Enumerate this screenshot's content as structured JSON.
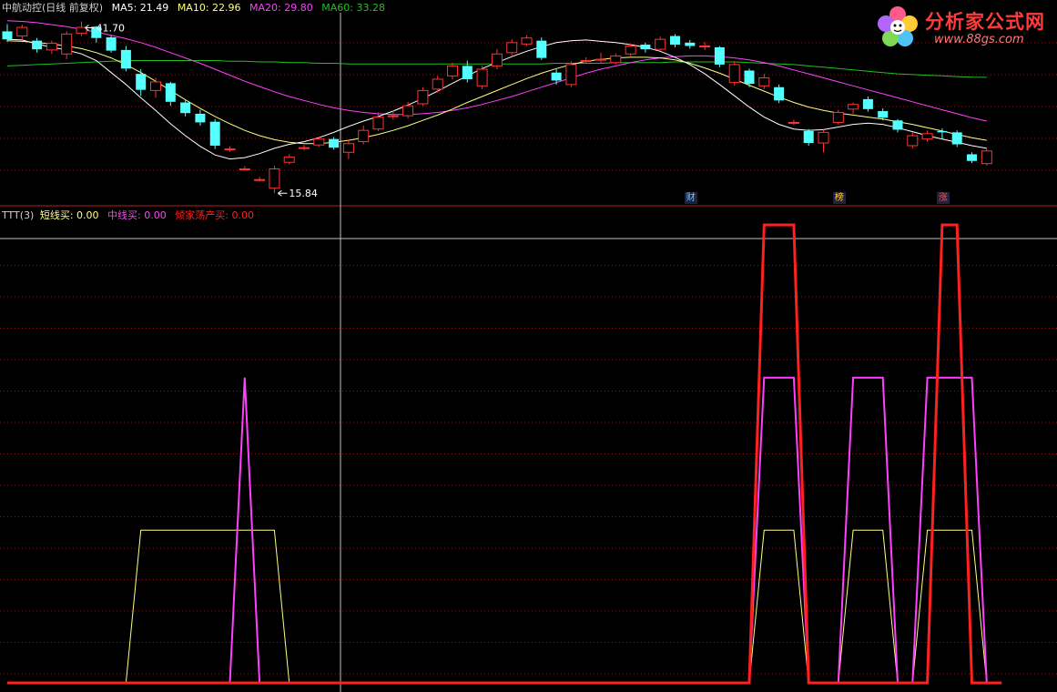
{
  "header_top": {
    "title": "中航动控(日线 前复权)",
    "ma5": "MA5: 21.49",
    "ma10": "MA10: 22.96",
    "ma20": "MA20: 29.80",
    "ma60": "MA60: 33.28"
  },
  "header_bottom": {
    "name": "TTT(3)",
    "short": "短线买: 0.00",
    "mid": "中线买: 0.00",
    "all": "倾家荡产买: 0.00"
  },
  "logo": {
    "text": "分析家公式网",
    "url": "www.88gs.com"
  },
  "colors": {
    "up": "#ff3333",
    "down": "#54ffff",
    "ma5": "#ffffff",
    "ma10": "#ffff80",
    "ma20": "#ff40ff",
    "ma60": "#20c020",
    "short": "#ffff80",
    "mid": "#ff40ff",
    "all": "#ff2020",
    "grid": "#801818",
    "cross": "#c0c0c0"
  },
  "chart_data": [
    {
      "type": "candlestick",
      "x_count": 67,
      "high_label": "41.70",
      "low_label": "15.84",
      "price_range": [
        14.5,
        43.0
      ],
      "candles": [
        [
          40.2,
          39.0,
          41.3,
          38.6
        ],
        [
          39.5,
          40.8,
          41.2,
          38.9
        ],
        [
          38.8,
          37.5,
          39.2,
          37.0
        ],
        [
          37.4,
          38.4,
          38.8,
          36.8
        ],
        [
          36.8,
          39.8,
          40.2,
          36.0
        ],
        [
          39.9,
          40.8,
          41.7,
          39.5
        ],
        [
          40.9,
          39.2,
          41.0,
          38.5
        ],
        [
          39.3,
          37.3,
          39.6,
          37.0
        ],
        [
          37.4,
          34.6,
          38.0,
          34.2
        ],
        [
          33.8,
          31.4,
          34.5,
          30.5
        ],
        [
          31.3,
          32.6,
          33.2,
          30.2
        ],
        [
          32.4,
          29.6,
          32.6,
          29.0
        ],
        [
          29.5,
          27.9,
          29.8,
          27.4
        ],
        [
          27.8,
          26.5,
          28.4,
          26.0
        ],
        [
          26.6,
          23.0,
          27.0,
          22.5
        ],
        [
          22.5,
          22.5,
          22.9,
          22.1
        ],
        [
          19.5,
          19.5,
          19.9,
          19.3
        ],
        [
          17.9,
          17.9,
          18.3,
          17.6
        ],
        [
          16.6,
          19.5,
          20.0,
          15.84
        ],
        [
          20.5,
          21.3,
          21.7,
          20.2
        ],
        [
          22.7,
          22.7,
          23.1,
          22.3
        ],
        [
          23.1,
          24.0,
          24.4,
          22.8
        ],
        [
          24.0,
          22.7,
          24.3,
          22.4
        ],
        [
          22.0,
          23.3,
          23.8,
          21.0
        ],
        [
          23.6,
          25.3,
          26.0,
          23.2
        ],
        [
          25.5,
          27.3,
          28.0,
          25.2
        ],
        [
          27.5,
          27.5,
          28.3,
          26.9
        ],
        [
          27.5,
          29.0,
          29.6,
          27.1
        ],
        [
          29.3,
          31.3,
          31.8,
          29.0
        ],
        [
          31.5,
          33.0,
          33.5,
          31.0
        ],
        [
          33.5,
          35.0,
          35.5,
          33.0
        ],
        [
          35.0,
          33.0,
          35.8,
          32.5
        ],
        [
          32.0,
          34.5,
          35.0,
          31.5
        ],
        [
          35.0,
          36.8,
          37.5,
          34.5
        ],
        [
          37.0,
          38.5,
          39.0,
          36.6
        ],
        [
          38.3,
          39.2,
          39.6,
          38.0
        ],
        [
          38.8,
          36.2,
          39.3,
          35.9
        ],
        [
          34.0,
          32.8,
          34.5,
          32.2
        ],
        [
          32.2,
          35.2,
          35.7,
          31.8
        ],
        [
          35.8,
          35.8,
          36.3,
          35.3
        ],
        [
          36.0,
          36.0,
          37.0,
          35.5
        ],
        [
          35.5,
          36.5,
          36.9,
          35.2
        ],
        [
          36.8,
          38.0,
          38.3,
          36.5
        ],
        [
          38.2,
          37.5,
          38.5,
          37.0
        ],
        [
          37.5,
          39.0,
          39.4,
          37.3
        ],
        [
          39.5,
          38.2,
          39.8,
          37.8
        ],
        [
          38.5,
          38.0,
          38.9,
          37.6
        ],
        [
          38.0,
          38.0,
          38.6,
          37.4
        ],
        [
          37.8,
          35.2,
          38.0,
          34.8
        ],
        [
          32.5,
          35.2,
          35.7,
          32.0
        ],
        [
          34.3,
          32.3,
          34.6,
          31.8
        ],
        [
          32.0,
          33.2,
          33.8,
          31.5
        ],
        [
          31.8,
          29.8,
          32.2,
          29.4
        ],
        [
          26.5,
          26.5,
          26.9,
          26.1
        ],
        [
          25.2,
          23.4,
          25.5,
          23.0
        ],
        [
          23.4,
          25.0,
          25.4,
          22.0
        ],
        [
          26.5,
          28.0,
          28.4,
          26.2
        ],
        [
          28.5,
          29.2,
          29.5,
          27.8
        ],
        [
          30.0,
          28.5,
          30.4,
          28.1
        ],
        [
          28.2,
          27.2,
          28.6,
          26.8
        ],
        [
          26.8,
          25.4,
          27.0,
          25.0
        ],
        [
          23.0,
          24.5,
          25.0,
          22.6
        ],
        [
          24.0,
          24.8,
          25.3,
          23.6
        ],
        [
          25.2,
          25.0,
          25.6,
          24.0
        ],
        [
          25.0,
          23.2,
          25.3,
          22.8
        ],
        [
          21.7,
          20.7,
          22.0,
          20.4
        ],
        [
          20.3,
          22.2,
          22.5,
          20.0
        ]
      ],
      "ma5": [
        39.0,
        38.9,
        38.3,
        37.8,
        37.4,
        36.8,
        35.8,
        34.0,
        32.2,
        30.2,
        28.3,
        26.3,
        24.5,
        22.9,
        21.6,
        21.0,
        21.2,
        21.8,
        22.6,
        23.2,
        23.6,
        24.2,
        25.0,
        25.9,
        26.7,
        27.4,
        28.2,
        29.1,
        30.1,
        31.2,
        32.4,
        33.5,
        34.6,
        35.5,
        36.4,
        37.2,
        37.9,
        38.5,
        38.8,
        38.9,
        38.7,
        38.5,
        38.2,
        37.8,
        37.2,
        36.3,
        35.2,
        33.8,
        32.2,
        30.5,
        28.8,
        27.3,
        26.2,
        25.5,
        25.3,
        25.4,
        25.8,
        26.2,
        26.4,
        26.2,
        25.7,
        25.1,
        24.5,
        24.0,
        23.5,
        23.0,
        22.6
      ],
      "ma10": [
        38.8,
        38.7,
        38.5,
        38.3,
        38.0,
        37.6,
        37.0,
        36.2,
        35.2,
        34.0,
        32.7,
        31.3,
        29.9,
        28.6,
        27.4,
        26.3,
        25.3,
        24.5,
        23.9,
        23.5,
        23.3,
        23.3,
        23.5,
        23.8,
        24.2,
        24.7,
        25.3,
        26.0,
        26.8,
        27.6,
        28.5,
        29.5,
        30.4,
        31.3,
        32.2,
        33.1,
        33.9,
        34.6,
        35.2,
        35.7,
        36.0,
        36.2,
        36.3,
        36.3,
        36.2,
        35.9,
        35.4,
        34.7,
        33.9,
        33.0,
        32.1,
        31.2,
        30.3,
        29.5,
        28.8,
        28.3,
        27.9,
        27.6,
        27.3,
        27.0,
        26.6,
        26.2,
        25.7,
        25.2,
        24.7,
        24.2,
        23.8
      ],
      "ma20": [
        41.8,
        41.7,
        41.5,
        41.2,
        40.9,
        40.5,
        40.1,
        39.6,
        39.1,
        38.5,
        37.8,
        37.0,
        36.2,
        35.4,
        34.5,
        33.6,
        32.7,
        31.9,
        31.1,
        30.4,
        29.8,
        29.2,
        28.7,
        28.3,
        28.0,
        27.8,
        27.7,
        27.7,
        27.8,
        28.0,
        28.3,
        28.7,
        29.2,
        29.8,
        30.4,
        31.1,
        31.8,
        32.5,
        33.2,
        33.9,
        34.5,
        35.0,
        35.5,
        35.9,
        36.2,
        36.4,
        36.5,
        36.5,
        36.4,
        36.2,
        35.9,
        35.5,
        35.0,
        34.4,
        33.8,
        33.2,
        32.6,
        32.0,
        31.4,
        30.8,
        30.2,
        29.6,
        29.0,
        28.4,
        27.8,
        27.2,
        26.7
      ],
      "ma60": [
        35.0,
        35.1,
        35.2,
        35.3,
        35.4,
        35.5,
        35.6,
        35.7,
        35.8,
        35.8,
        35.8,
        35.8,
        35.8,
        35.8,
        35.8,
        35.7,
        35.7,
        35.6,
        35.6,
        35.5,
        35.5,
        35.4,
        35.4,
        35.3,
        35.3,
        35.3,
        35.3,
        35.3,
        35.3,
        35.3,
        35.3,
        35.3,
        35.3,
        35.3,
        35.3,
        35.3,
        35.3,
        35.4,
        35.4,
        35.4,
        35.4,
        35.5,
        35.5,
        35.5,
        35.5,
        35.6,
        35.6,
        35.6,
        35.6,
        35.6,
        35.5,
        35.4,
        35.3,
        35.2,
        35.0,
        34.8,
        34.6,
        34.4,
        34.2,
        34.0,
        33.8,
        33.7,
        33.6,
        33.5,
        33.4,
        33.3,
        33.28
      ],
      "events": [
        {
          "x": 46,
          "label": "财"
        },
        {
          "x": 56,
          "label": "榜"
        },
        {
          "x": 63,
          "label": "涨"
        }
      ]
    },
    {
      "type": "line",
      "name": "TTT(3)",
      "y_range": [
        0,
        3
      ],
      "series": [
        {
          "name": "短线买",
          "color_key": "short",
          "points": [
            [
              0,
              0
            ],
            [
              8,
              0
            ],
            [
              9,
              1
            ],
            [
              18,
              1
            ],
            [
              19,
              0
            ],
            [
              50,
              0
            ],
            [
              51,
              1
            ],
            [
              53,
              1
            ],
            [
              54,
              0
            ],
            [
              56,
              0
            ],
            [
              57,
              1
            ],
            [
              59,
              1
            ],
            [
              60,
              0
            ],
            [
              61,
              0
            ],
            [
              62,
              1
            ],
            [
              65,
              1
            ],
            [
              66,
              0
            ],
            [
              67,
              0
            ]
          ]
        },
        {
          "name": "中线买",
          "color_key": "mid",
          "points": [
            [
              0,
              0
            ],
            [
              15,
              0
            ],
            [
              16,
              2
            ],
            [
              17,
              0
            ],
            [
              50,
              0
            ],
            [
              51,
              2
            ],
            [
              53,
              2
            ],
            [
              54,
              0
            ],
            [
              56,
              0
            ],
            [
              57,
              2
            ],
            [
              59,
              2
            ],
            [
              60,
              0
            ],
            [
              61,
              0
            ],
            [
              62,
              2
            ],
            [
              65,
              2
            ],
            [
              66,
              0
            ],
            [
              67,
              0
            ]
          ]
        },
        {
          "name": "倾家荡产买",
          "color_key": "all",
          "points": [
            [
              0,
              0
            ],
            [
              50,
              0
            ],
            [
              51,
              3
            ],
            [
              53,
              3
            ],
            [
              54,
              0
            ],
            [
              62,
              0
            ],
            [
              63,
              3
            ],
            [
              64,
              3
            ],
            [
              65,
              0
            ],
            [
              67,
              0
            ]
          ]
        }
      ]
    }
  ]
}
